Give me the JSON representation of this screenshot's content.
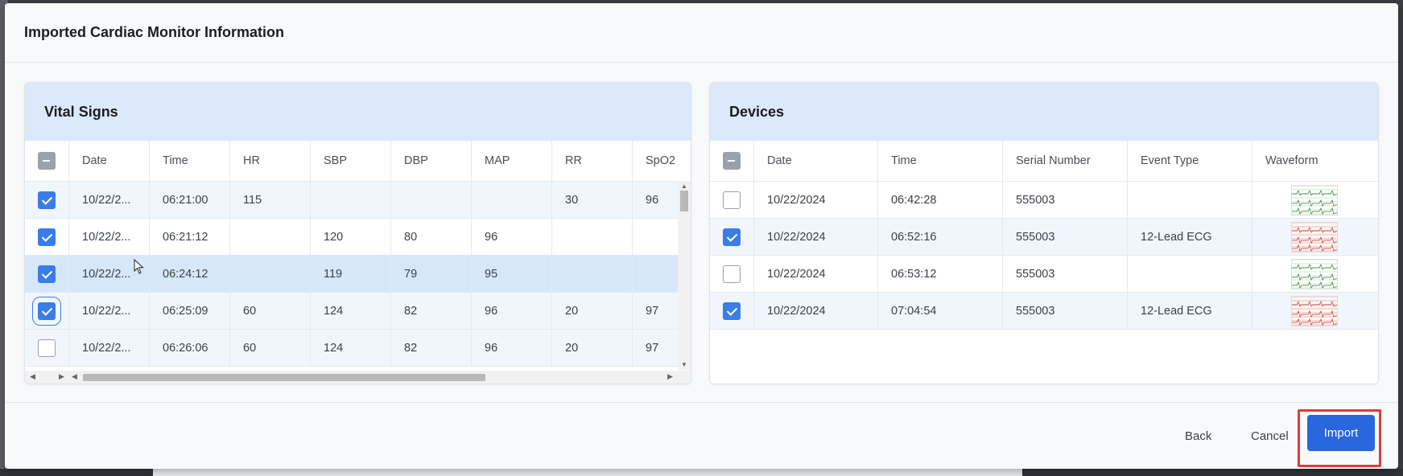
{
  "modal": {
    "title": "Imported Cardiac Monitor Information"
  },
  "vitals": {
    "title": "Vital Signs",
    "columns": [
      "Date",
      "Time",
      "HR",
      "SBP",
      "DBP",
      "MAP",
      "RR",
      "SpO2"
    ],
    "rows": [
      {
        "checked": true,
        "date": "10/22/2...",
        "time": "06:21:00",
        "hr": "115",
        "sbp": "",
        "dbp": "",
        "map": "",
        "rr": "30",
        "spo2": "96"
      },
      {
        "checked": true,
        "date": "10/22/2...",
        "time": "06:21:12",
        "hr": "",
        "sbp": "120",
        "dbp": "80",
        "map": "96",
        "rr": "",
        "spo2": ""
      },
      {
        "checked": true,
        "date": "10/22/2...",
        "time": "06:24:12",
        "hr": "",
        "sbp": "119",
        "dbp": "79",
        "map": "95",
        "rr": "",
        "spo2": ""
      },
      {
        "checked": true,
        "date": "10/22/2...",
        "time": "06:25:09",
        "hr": "60",
        "sbp": "124",
        "dbp": "82",
        "map": "96",
        "rr": "20",
        "spo2": "97"
      },
      {
        "checked": false,
        "date": "10/22/2...",
        "time": "06:26:06",
        "hr": "60",
        "sbp": "124",
        "dbp": "82",
        "map": "96",
        "rr": "20",
        "spo2": "97"
      }
    ]
  },
  "devices": {
    "title": "Devices",
    "columns": [
      "Date",
      "Time",
      "Serial Number",
      "Event Type",
      "Waveform"
    ],
    "rows": [
      {
        "checked": false,
        "date": "10/22/2024",
        "time": "06:42:28",
        "serial": "555003",
        "event": "",
        "waveform": "green"
      },
      {
        "checked": true,
        "date": "10/22/2024",
        "time": "06:52:16",
        "serial": "555003",
        "event": "12-Lead ECG",
        "waveform": "red"
      },
      {
        "checked": false,
        "date": "10/22/2024",
        "time": "06:53:12",
        "serial": "555003",
        "event": "",
        "waveform": "green"
      },
      {
        "checked": true,
        "date": "10/22/2024",
        "time": "07:04:54",
        "serial": "555003",
        "event": "12-Lead ECG",
        "waveform": "red"
      }
    ]
  },
  "footer": {
    "back_label": "Back",
    "cancel_label": "Cancel",
    "import_label": "Import"
  },
  "colors": {
    "primary": "#2a66dd",
    "panel_header": "#dbe9fb",
    "checkbox_on": "#3b7de8",
    "highlight": "#e23b3b"
  }
}
